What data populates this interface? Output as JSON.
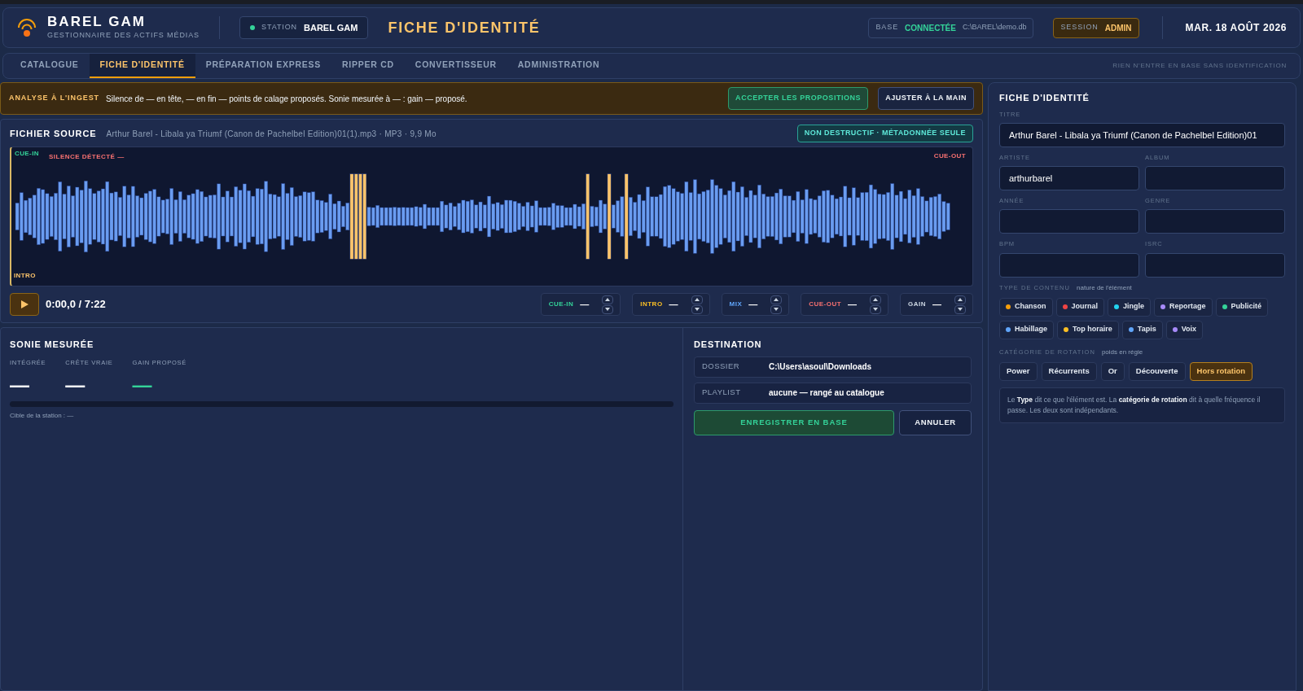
{
  "brand": {
    "name": "BAREL GAM",
    "subtitle": "GESTIONNAIRE DES ACTIFS MÉDIAS"
  },
  "station": {
    "label": "STATION",
    "value": "BAREL GAM",
    "online": true
  },
  "page_title": "FICHE D'IDENTITÉ",
  "database": {
    "label": "BASE",
    "status": "CONNECTÉE",
    "path": "C:\\BAREL\\demo.db"
  },
  "session": {
    "label": "SESSION",
    "value": "ADMIN"
  },
  "date": "MAR. 18 AOÛT 2026",
  "tabs": [
    {
      "label": "CATALOGUE",
      "selected": false
    },
    {
      "label": "FICHE D'IDENTITÉ",
      "selected": true
    },
    {
      "label": "PRÉPARATION EXPRESS",
      "selected": false
    },
    {
      "label": "RIPPER CD",
      "selected": false
    },
    {
      "label": "CONVERTISSEUR",
      "selected": false
    },
    {
      "label": "ADMINISTRATION",
      "selected": false
    }
  ],
  "tabs_note": "RIEN N'ENTRE EN BASE SANS IDENTIFICATION",
  "analysis": {
    "label": "ANALYSE À L'INGEST",
    "message": "Silence de — en tête, — en fin — points de calage proposés. Sonie mesurée à — : gain — proposé.",
    "accept": "ACCEPTER LES PROPOSITIONS",
    "adjust": "AJUSTER À LA MAIN"
  },
  "source": {
    "title": "FICHIER SOURCE",
    "file": "Arthur Barel - Libala ya Triumf (Canon de Pachelbel Edition)01(1).mp3 · MP3 · 9,9 Mo",
    "badge": "NON DESTRUCTIF · MÉTADONNÉE SEULE",
    "markers": {
      "cue_in": "CUE-IN",
      "silence": "SILENCE DÉTECTÉ —",
      "cue_out": "CUE-OUT",
      "intro": "INTRO"
    },
    "time": "0:00,0 / 7:22",
    "cues": [
      {
        "label": "CUE-IN",
        "value": "—",
        "color": "#34d399"
      },
      {
        "label": "INTRO",
        "value": "—",
        "color": "#fbbf24"
      },
      {
        "label": "MIX",
        "value": "—",
        "color": "#60a5fa"
      },
      {
        "label": "CUE-OUT",
        "value": "—",
        "color": "#f87171"
      },
      {
        "label": "GAIN",
        "value": "—",
        "color": "#cbd5e1"
      }
    ]
  },
  "loudness": {
    "title": "SONIE MESURÉE",
    "metrics": [
      {
        "label": "INTÉGRÉE",
        "value": "—",
        "color": "#ffffff"
      },
      {
        "label": "CRÊTE VRAIE",
        "value": "—",
        "color": "#ffffff"
      },
      {
        "label": "GAIN PROPOSÉ",
        "value": "—",
        "color": "#34d399"
      }
    ],
    "level": 0,
    "target": "Cible de la station : —"
  },
  "destination": {
    "title": "DESTINATION",
    "rows": [
      {
        "label": "DOSSIER",
        "value": "C:\\Users\\asoul\\Downloads"
      },
      {
        "label": "PLAYLIST",
        "value": "aucune — rangé au catalogue"
      }
    ],
    "save": "ENREGISTRER EN BASE",
    "cancel": "ANNULER"
  },
  "identity": {
    "title": "FICHE D'IDENTITÉ",
    "title_field": {
      "label": "TITRE",
      "value": "Arthur Barel - Libala ya Triumf (Canon de Pachelbel Edition)01"
    },
    "fields": [
      {
        "label": "ARTISTE",
        "value": "arthurbarel"
      },
      {
        "label": "ALBUM"
      },
      {
        "label": "ANNÉE"
      },
      {
        "label": "GENRE"
      },
      {
        "label": "BPM"
      },
      {
        "label": "ISRC"
      }
    ],
    "type_label": "TYPE DE CONTENU",
    "type_hint": "nature de l'élément",
    "types": [
      {
        "label": "Chanson",
        "color": "#f59e0b",
        "selected": false
      },
      {
        "label": "Journal",
        "color": "#ef4444",
        "selected": false
      },
      {
        "label": "Jingle",
        "color": "#22d3ee",
        "selected": false
      },
      {
        "label": "Reportage",
        "color": "#a78bfa",
        "selected": false
      },
      {
        "label": "Publicité",
        "color": "#34d399",
        "selected": false
      },
      {
        "label": "Habillage",
        "color": "#60a5fa",
        "selected": false
      },
      {
        "label": "Top horaire",
        "color": "#fbbf24",
        "selected": false
      },
      {
        "label": "Tapis",
        "color": "#60a5fa",
        "selected": false
      },
      {
        "label": "Voix",
        "color": "#a78bfa",
        "selected": false
      }
    ],
    "rotation_label": "CATÉGORIE DE ROTATION",
    "rotation_hint": "poids en régie",
    "rotations": [
      {
        "label": "Power",
        "selected": false
      },
      {
        "label": "Récurrents",
        "selected": false
      },
      {
        "label": "Or",
        "selected": false
      },
      {
        "label": "Découverte",
        "selected": false
      },
      {
        "label": "Hors rotation",
        "selected": true
      }
    ],
    "note": "Le **Type** dit ce que l'élément est. La **catégorie de rotation** dit à quelle fréquence il passe. Les deux sont indépendants."
  }
}
